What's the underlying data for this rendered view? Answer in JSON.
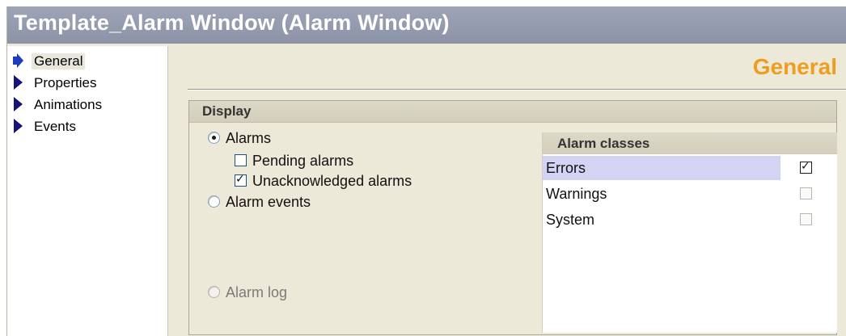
{
  "window": {
    "title": "Template_Alarm Window (Alarm Window)"
  },
  "nav": {
    "items": [
      {
        "label": "General",
        "active": true
      },
      {
        "label": "Properties",
        "active": false
      },
      {
        "label": "Animations",
        "active": false
      },
      {
        "label": "Events",
        "active": false
      }
    ],
    "active_arrow_color": "#1e3cbe",
    "arrow_color": "#141478"
  },
  "content": {
    "heading": "General",
    "heading_color": "#ef9d1e",
    "display": {
      "title": "Display",
      "options": {
        "alarms": {
          "label": "Alarms",
          "selected": true
        },
        "pending_alarms": {
          "label": "Pending alarms",
          "checked": false
        },
        "unacknowledged_alarms": {
          "label": "Unacknowledged alarms",
          "checked": true
        },
        "alarm_events": {
          "label": "Alarm events",
          "selected": false
        },
        "alarm_log": {
          "label": "Alarm log",
          "selected": false,
          "enabled": false
        }
      }
    },
    "alarm_classes": {
      "title": "Alarm classes",
      "rows": [
        {
          "name": "Errors",
          "checked": true,
          "selected": true
        },
        {
          "name": "Warnings",
          "checked": false,
          "selected": false
        },
        {
          "name": "System",
          "checked": false,
          "selected": false
        }
      ]
    }
  }
}
